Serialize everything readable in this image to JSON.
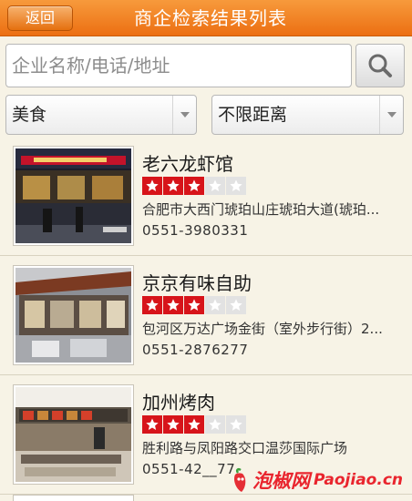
{
  "header": {
    "back_label": "返回",
    "title": "商企检索结果列表"
  },
  "search": {
    "placeholder": "企业名称/电话/地址",
    "value": ""
  },
  "filters": {
    "category": "美食",
    "distance": "不限距离"
  },
  "results": [
    {
      "name": "老六龙虾馆",
      "rating": 3,
      "max_rating": 5,
      "address": "合肥市大西门琥珀山庄琥珀大道(琥珀...",
      "phone": "0551-3980331"
    },
    {
      "name": "京京有味自助",
      "rating": 3,
      "max_rating": 5,
      "address": "包河区万达广场金街（室外步行街）2...",
      "phone": "0551-2876277"
    },
    {
      "name": "加州烤肉",
      "rating": 3,
      "max_rating": 5,
      "address": "胜利路与凤阳路交口温莎国际广场",
      "phone": "0551-42__77"
    }
  ],
  "watermark": {
    "cn": "泡椒网",
    "en": "Paojiao.cn"
  },
  "colors": {
    "header_orange": "#ec6f12",
    "star_red": "#d7141a",
    "background": "#f7f3e6"
  }
}
